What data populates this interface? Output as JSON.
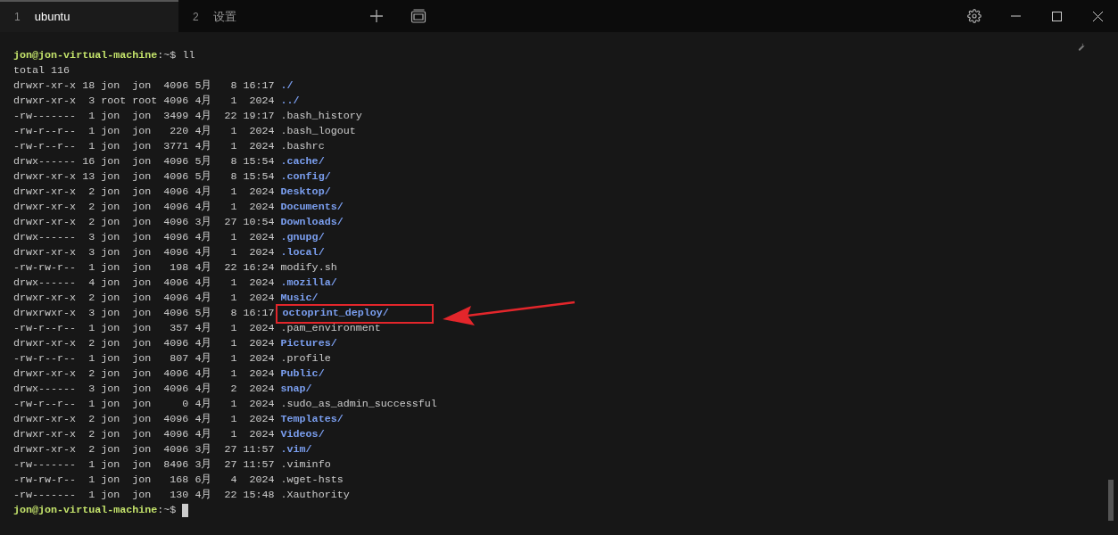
{
  "tabs": [
    {
      "index": "1",
      "label": "ubuntu",
      "selected": true
    },
    {
      "index": "2",
      "label": "设置",
      "selected": false
    }
  ],
  "terminal": {
    "prompt": {
      "user_host": "jon@jon-virtual-machine",
      "path": ":~",
      "symbol": "$"
    },
    "command": "ll",
    "total": "total 116",
    "rows": [
      {
        "meta": "drwxr-xr-x 18 jon  jon  4096 5月   8 16:17",
        "name": "./",
        "kind": "dir",
        "highlighted": false
      },
      {
        "meta": "drwxr-xr-x  3 root root 4096 4月   1  2024",
        "name": "../",
        "kind": "dir",
        "highlighted": false
      },
      {
        "meta": "-rw-------  1 jon  jon  3499 4月  22 19:17",
        "name": ".bash_history",
        "kind": "file",
        "highlighted": false
      },
      {
        "meta": "-rw-r--r--  1 jon  jon   220 4月   1  2024",
        "name": ".bash_logout",
        "kind": "file",
        "highlighted": false
      },
      {
        "meta": "-rw-r--r--  1 jon  jon  3771 4月   1  2024",
        "name": ".bashrc",
        "kind": "file",
        "highlighted": false
      },
      {
        "meta": "drwx------ 16 jon  jon  4096 5月   8 15:54",
        "name": ".cache/",
        "kind": "dir",
        "highlighted": false
      },
      {
        "meta": "drwxr-xr-x 13 jon  jon  4096 5月   8 15:54",
        "name": ".config/",
        "kind": "dir",
        "highlighted": false
      },
      {
        "meta": "drwxr-xr-x  2 jon  jon  4096 4月   1  2024",
        "name": "Desktop/",
        "kind": "dir",
        "highlighted": false
      },
      {
        "meta": "drwxr-xr-x  2 jon  jon  4096 4月   1  2024",
        "name": "Documents/",
        "kind": "dir",
        "highlighted": false
      },
      {
        "meta": "drwxr-xr-x  2 jon  jon  4096 3月  27 10:54",
        "name": "Downloads/",
        "kind": "dir",
        "highlighted": false
      },
      {
        "meta": "drwx------  3 jon  jon  4096 4月   1  2024",
        "name": ".gnupg/",
        "kind": "dir",
        "highlighted": false
      },
      {
        "meta": "drwxr-xr-x  3 jon  jon  4096 4月   1  2024",
        "name": ".local/",
        "kind": "dir",
        "highlighted": false
      },
      {
        "meta": "-rw-rw-r--  1 jon  jon   198 4月  22 16:24",
        "name": "modify.sh",
        "kind": "file",
        "highlighted": false
      },
      {
        "meta": "drwx------  4 jon  jon  4096 4月   1  2024",
        "name": ".mozilla/",
        "kind": "dir",
        "highlighted": false
      },
      {
        "meta": "drwxr-xr-x  2 jon  jon  4096 4月   1  2024",
        "name": "Music/",
        "kind": "dir",
        "highlighted": false
      },
      {
        "meta": "drwxrwxr-x  3 jon  jon  4096 5月   8 16:17",
        "name": "octoprint_deploy/",
        "kind": "dir",
        "highlighted": true
      },
      {
        "meta": "-rw-r--r--  1 jon  jon   357 4月   1  2024",
        "name": ".pam_environment",
        "kind": "file",
        "highlighted": false
      },
      {
        "meta": "drwxr-xr-x  2 jon  jon  4096 4月   1  2024",
        "name": "Pictures/",
        "kind": "dir",
        "highlighted": false
      },
      {
        "meta": "-rw-r--r--  1 jon  jon   807 4月   1  2024",
        "name": ".profile",
        "kind": "file",
        "highlighted": false
      },
      {
        "meta": "drwxr-xr-x  2 jon  jon  4096 4月   1  2024",
        "name": "Public/",
        "kind": "dir",
        "highlighted": false
      },
      {
        "meta": "drwx------  3 jon  jon  4096 4月   2  2024",
        "name": "snap/",
        "kind": "dir",
        "highlighted": false
      },
      {
        "meta": "-rw-r--r--  1 jon  jon     0 4月   1  2024",
        "name": ".sudo_as_admin_successful",
        "kind": "file",
        "highlighted": false
      },
      {
        "meta": "drwxr-xr-x  2 jon  jon  4096 4月   1  2024",
        "name": "Templates/",
        "kind": "dir",
        "highlighted": false
      },
      {
        "meta": "drwxr-xr-x  2 jon  jon  4096 4月   1  2024",
        "name": "Videos/",
        "kind": "dir",
        "highlighted": false
      },
      {
        "meta": "drwxr-xr-x  2 jon  jon  4096 3月  27 11:57",
        "name": ".vim/",
        "kind": "dir",
        "highlighted": false
      },
      {
        "meta": "-rw-------  1 jon  jon  8496 3月  27 11:57",
        "name": ".viminfo",
        "kind": "file",
        "highlighted": false
      },
      {
        "meta": "-rw-rw-r--  1 jon  jon   168 6月   4  2024",
        "name": ".wget-hsts",
        "kind": "file",
        "highlighted": false
      },
      {
        "meta": "-rw-------  1 jon  jon   130 4月  22 15:48",
        "name": ".Xauthority",
        "kind": "file",
        "highlighted": false
      }
    ],
    "final_prompt": {
      "user_host": "jon@jon-virtual-machine",
      "path": ":~",
      "symbol": "$"
    }
  }
}
